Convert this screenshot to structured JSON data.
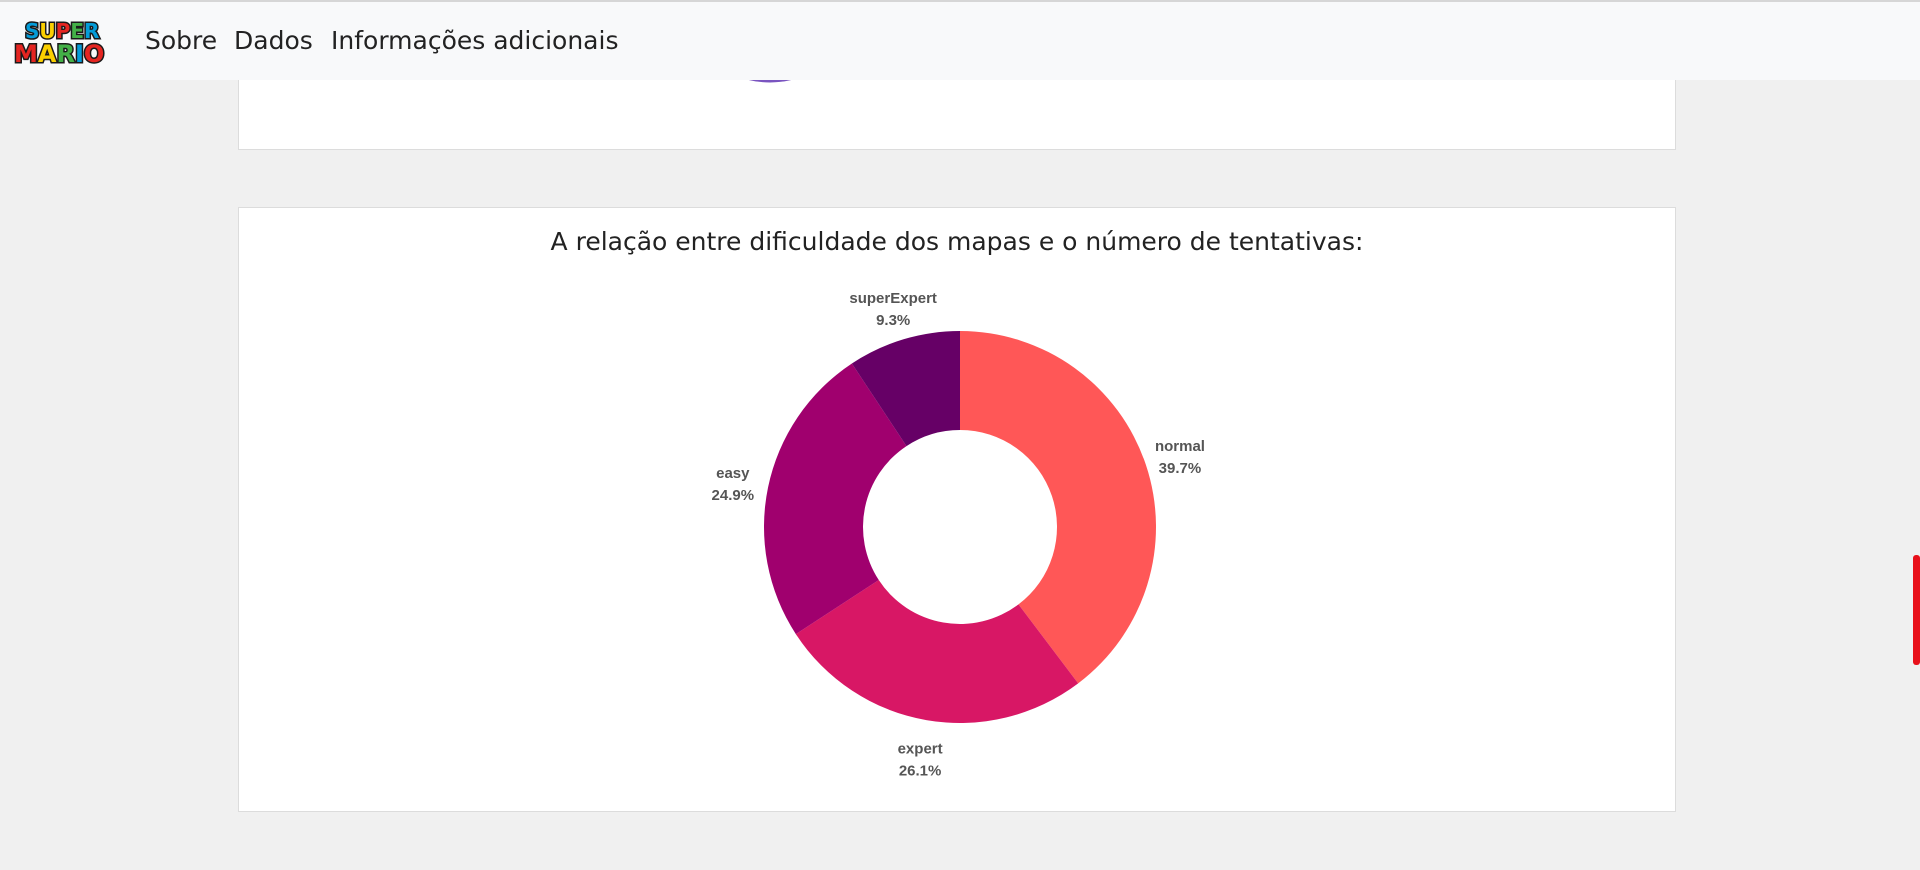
{
  "navbar": {
    "logo": {
      "line1": "SUPER",
      "line2": "MARIO"
    },
    "items": [
      {
        "label": "Sobre"
      },
      {
        "label": "Dados"
      },
      {
        "label": "Informações adicionais"
      }
    ]
  },
  "colors": {
    "normal": "#ff5757",
    "expert": "#d81765",
    "easy": "#a0006e",
    "superExpert": "#660066",
    "previous_chart": "#7a55c0",
    "scrollbar_thumb": "#e8101a"
  },
  "chart_data": {
    "type": "pie",
    "title": "A relação entre dificuldade dos mapas e o número de tentativas:",
    "donut": true,
    "labels": [
      "normal",
      "expert",
      "easy",
      "superExpert"
    ],
    "values": [
      39.7,
      26.1,
      24.9,
      9.3
    ],
    "value_labels": [
      "39.7%",
      "26.1%",
      "24.9%",
      "9.3%"
    ],
    "colors": [
      "#ff5757",
      "#d81765",
      "#a0006e",
      "#660066"
    ]
  }
}
